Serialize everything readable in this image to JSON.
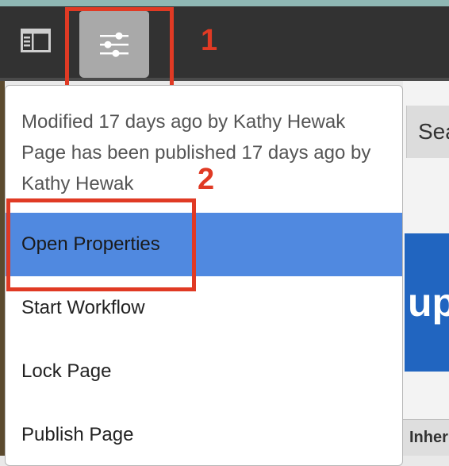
{
  "toolbar": {
    "side_panel_icon": "side-panel-icon",
    "page_info_icon": "sliders-icon"
  },
  "callouts": {
    "one": "1",
    "two": "2"
  },
  "menu": {
    "info_lines": [
      "Modified 17 days ago by Kathy Hewak",
      "Page has been published 17 days ago by",
      "Kathy Hewak"
    ],
    "items": [
      {
        "label": "Open Properties",
        "active": true
      },
      {
        "label": "Start Workflow"
      },
      {
        "label": "Lock Page"
      },
      {
        "label": "Publish Page"
      }
    ]
  },
  "background": {
    "search_text": "Sea",
    "hero_text": "up",
    "inherit_text": "Inher"
  },
  "colors": {
    "toolbar": "#323232",
    "highlight": "#5089e0",
    "callout": "#e03a24",
    "hero": "#2165c0"
  }
}
